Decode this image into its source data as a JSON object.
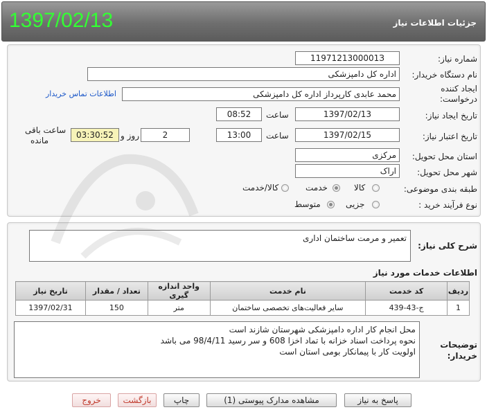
{
  "header": {
    "date": "1397/02/13",
    "title": "جزئیات اطلاعات نیاز"
  },
  "form": {
    "need_number_label": "شماره نیاز:",
    "need_number": "1197121300001З",
    "buyer_label": "نام دستگاه خریدار:",
    "buyer": "اداره کل دامپزشکی",
    "creator_label_1": "ایجاد کننده",
    "creator_label_2": "درخواست:",
    "creator": "محمد عابدی کارپرداز اداره کل دامپزشکی",
    "contact_link": "اطلاعات تماس خریدار",
    "created_date_label": "تاریخ ایجاد نیاز:",
    "created_date": "1397/02/13",
    "time_label": "ساعت",
    "created_time": "08:52",
    "valid_date_label": "تاریخ اعتبار نیاز:",
    "valid_date": "1397/02/15",
    "valid_time": "13:00",
    "days_label": "روز و",
    "days": "2",
    "remaining": "03:30:52",
    "remaining_label_1": "ساعت باقی",
    "remaining_label_2": "مانده",
    "province_label": "استان محل تحویل:",
    "province": "مرکزی",
    "city_label": "شهر محل تحویل:",
    "city": "اراک",
    "category_label": "طبقه بندی موضوعی:",
    "category_options": [
      "کالا",
      "خدمت",
      "کالا/خدمت"
    ],
    "category_selected": "خدمت",
    "process_label": "نوع فرآیند خرید :",
    "process_options": [
      "جزیی",
      "متوسط"
    ],
    "process_selected": "متوسط"
  },
  "summary": {
    "label": "شرح کلی نیاز:",
    "text": "تعمیر و مرمت ساختمان اداری"
  },
  "services": {
    "title": "اطلاعات خدمات مورد نیاز",
    "columns": [
      "ردیف",
      "کد خدمت",
      "نام خدمت",
      "واحد اندازه گیری",
      "تعداد / مقدار",
      "تاریخ نیاز"
    ],
    "rows": [
      {
        "row": "1",
        "code": "ج-43-439",
        "name": "سایر فعالیت‌های تخصصی ساختمان",
        "unit": "متر",
        "qty": "150",
        "date": "1397/02/31"
      }
    ]
  },
  "notes": {
    "label_1": "توضیحات",
    "label_2": "خریدار:",
    "lines": [
      "محل انجام کار اداره دامپزشکی شهرستان شازند است",
      "نحوه پرداخت اسناد خزانه با تماد اخزا 608 و سر رسید 98/4/11 می باشد",
      "اولویت کار با پیمانکار بومی استان است"
    ]
  },
  "buttons": {
    "reply": "پاسخ به نیاز",
    "attachments": "مشاهده مدارک پیوستی (1)",
    "print": "چاپ",
    "back": "بازگشت",
    "exit": "خروج"
  }
}
